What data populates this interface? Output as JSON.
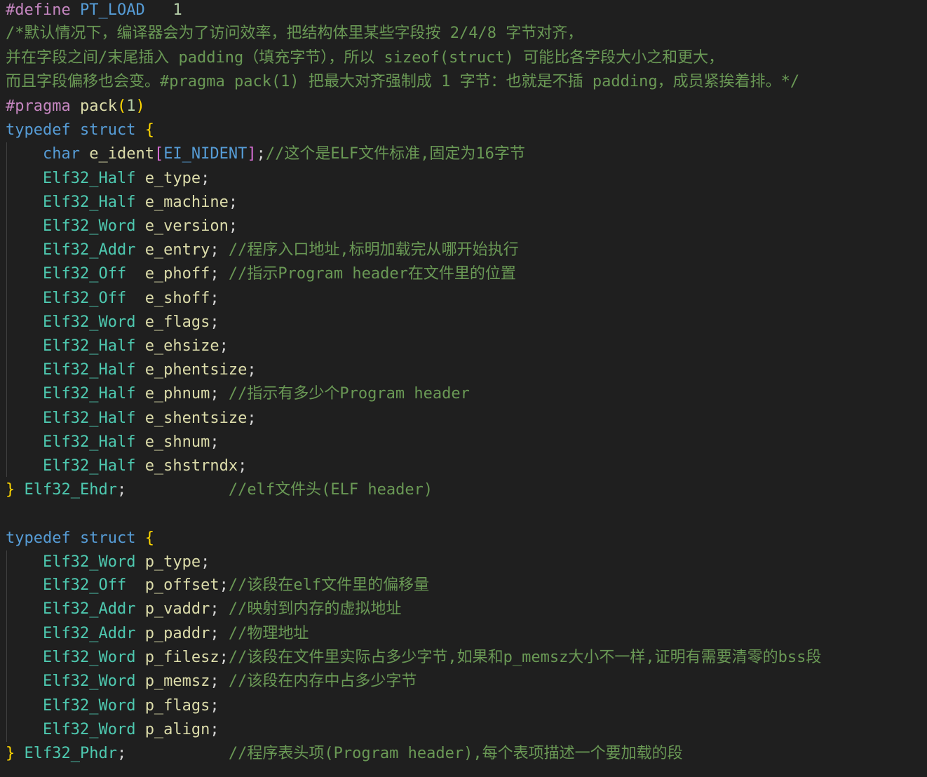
{
  "code": {
    "define": {
      "directive": "#define",
      "name": "PT_LOAD",
      "value": "1"
    },
    "comment_block": [
      "/*默认情况下，编译器会为了访问效率，把结构体里某些字段按 2/4/8 字节对齐，",
      "并在字段之间/末尾插入 padding（填充字节），所以 sizeof(struct) 可能比各字段大小之和更大，",
      "而且字段偏移也会变。#pragma pack(1) 把最大对齐强制成 1 字节：也就是不插 padding，成员紧挨着排。*/"
    ],
    "pragma": {
      "directive": "#pragma",
      "name": "pack",
      "open": "(",
      "value": "1",
      "close": ")"
    },
    "ehdr": {
      "typedef_kw": "typedef",
      "struct_kw": "struct",
      "open_brace": "{",
      "ident_line": {
        "type": "char",
        "name": "e_ident",
        "lbracket": "[",
        "size": "EI_NIDENT",
        "rbracket": "]",
        "semi": ";",
        "comment": "//这个是ELF文件标准,固定为16字节"
      },
      "fields": [
        {
          "type": "Elf32_Half",
          "name": "e_type",
          "semi": ";",
          "comment": ""
        },
        {
          "type": "Elf32_Half",
          "name": "e_machine",
          "semi": ";",
          "comment": ""
        },
        {
          "type": "Elf32_Word",
          "name": "e_version",
          "semi": ";",
          "comment": ""
        },
        {
          "type": "Elf32_Addr",
          "name": "e_entry",
          "semi": "; ",
          "comment": "//程序入口地址,标明加载完从哪开始执行"
        },
        {
          "type": "Elf32_Off ",
          "name": "e_phoff",
          "semi": "; ",
          "comment": "//指示Program header在文件里的位置"
        },
        {
          "type": "Elf32_Off ",
          "name": "e_shoff",
          "semi": ";",
          "comment": ""
        },
        {
          "type": "Elf32_Word",
          "name": "e_flags",
          "semi": ";",
          "comment": ""
        },
        {
          "type": "Elf32_Half",
          "name": "e_ehsize",
          "semi": ";",
          "comment": ""
        },
        {
          "type": "Elf32_Half",
          "name": "e_phentsize",
          "semi": ";",
          "comment": ""
        },
        {
          "type": "Elf32_Half",
          "name": "e_phnum",
          "semi": "; ",
          "comment": "//指示有多少个Program header"
        },
        {
          "type": "Elf32_Half",
          "name": "e_shentsize",
          "semi": ";",
          "comment": ""
        },
        {
          "type": "Elf32_Half",
          "name": "e_shnum",
          "semi": ";",
          "comment": ""
        },
        {
          "type": "Elf32_Half",
          "name": "e_shstrndx",
          "semi": ";",
          "comment": ""
        }
      ],
      "close_brace": "}",
      "type_name": "Elf32_Ehdr",
      "end_semi": ";",
      "comment": "//elf文件头(ELF header)"
    },
    "phdr": {
      "typedef_kw": "typedef",
      "struct_kw": "struct",
      "open_brace": "{",
      "fields": [
        {
          "type": "Elf32_Word",
          "name": "p_type",
          "semi": ";",
          "comment": ""
        },
        {
          "type": "Elf32_Off ",
          "name": "p_offset",
          "semi": ";",
          "comment": "//该段在elf文件里的偏移量"
        },
        {
          "type": "Elf32_Addr",
          "name": "p_vaddr",
          "semi": "; ",
          "comment": "//映射到内存的虚拟地址"
        },
        {
          "type": "Elf32_Addr",
          "name": "p_paddr",
          "semi": "; ",
          "comment": "//物理地址"
        },
        {
          "type": "Elf32_Word",
          "name": "p_filesz",
          "semi": ";",
          "comment": "//该段在文件里实际占多少字节,如果和p_memsz大小不一样,证明有需要清零的bss段"
        },
        {
          "type": "Elf32_Word",
          "name": "p_memsz",
          "semi": "; ",
          "comment": "//该段在内存中占多少字节"
        },
        {
          "type": "Elf32_Word",
          "name": "p_flags",
          "semi": ";",
          "comment": ""
        },
        {
          "type": "Elf32_Word",
          "name": "p_align",
          "semi": ";",
          "comment": ""
        }
      ],
      "close_brace": "}",
      "type_name": "Elf32_Phdr",
      "end_semi": ";",
      "comment": "//程序表头项(Program header),每个表项描述一个要加载的段"
    }
  }
}
